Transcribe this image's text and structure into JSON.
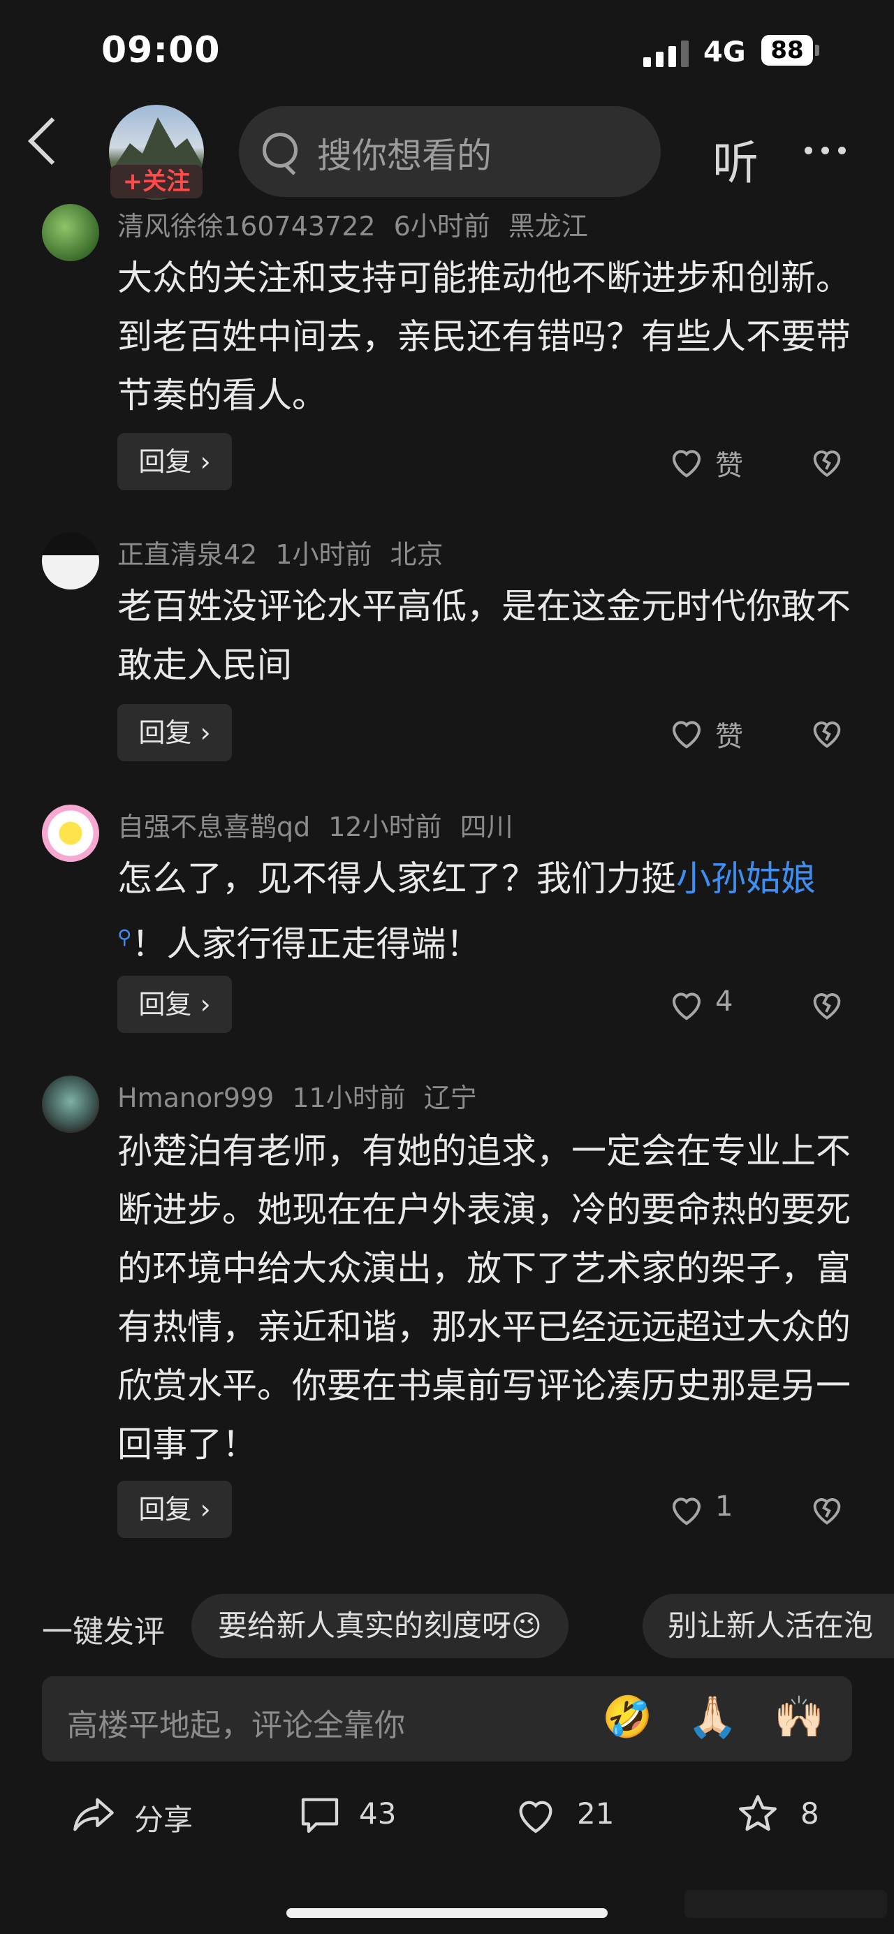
{
  "status_bar": {
    "time": "09:00",
    "network": "4G",
    "battery": "88"
  },
  "top_bar": {
    "follow_label": "+关注",
    "search_placeholder": "搜你想看的",
    "listen_label": "听"
  },
  "comments": [
    {
      "user": "清风徐徐160743722",
      "time": "6小时前",
      "location": "黑龙江",
      "text": "大众的关注和支持可能推动他不断进步和创新。到老百姓中间去，亲民还有错吗？有些人不要带节奏的看人。",
      "reply_label": "回复 ›",
      "like_label": "赞"
    },
    {
      "user": "正直清泉42",
      "time": "1小时前",
      "location": "北京",
      "text": "老百姓没评论水平高低，是在这金元时代你敢不敢走入民间",
      "reply_label": "回复 ›",
      "like_label": "赞"
    },
    {
      "user": "自强不息喜鹊qd",
      "time": "12小时前",
      "location": "四川",
      "text_before": "怎么了，见不得人家红了？我们力挺",
      "link_text": "小孙姑娘",
      "text_after": "！人家行得正走得端！",
      "reply_label": "回复 ›",
      "like_label": "4"
    },
    {
      "user": "Hmanor999",
      "time": "11小时前",
      "location": "辽宁",
      "text": "孙楚泊有老师，有她的追求，一定会在专业上不断进步。她现在在户外表演，冷的要命热的要死的环境中给大众演出，放下了艺术家的架子，富有热情，亲近和谐，那水平已经远远超过大众的欣赏水平。你要在书桌前写评论凑历史那是另一回事了！",
      "reply_label": "回复 ›",
      "like_label": "1"
    }
  ],
  "quick_comment": {
    "label": "一键发评",
    "chips": [
      "要给新人真实的刻度呀😉",
      "别让新人活在泡"
    ],
    "input_placeholder": "高楼平地起，评论全靠你",
    "emojis": [
      "🤣",
      "🙏🏻",
      "🙌🏻"
    ]
  },
  "bottom_bar": {
    "share_label": "分享",
    "comment_count": "43",
    "like_count": "21",
    "favorite_count": "8"
  },
  "colors": {
    "background": "#161616",
    "link": "#3f8ff2",
    "follow": "#ff4b4b"
  }
}
